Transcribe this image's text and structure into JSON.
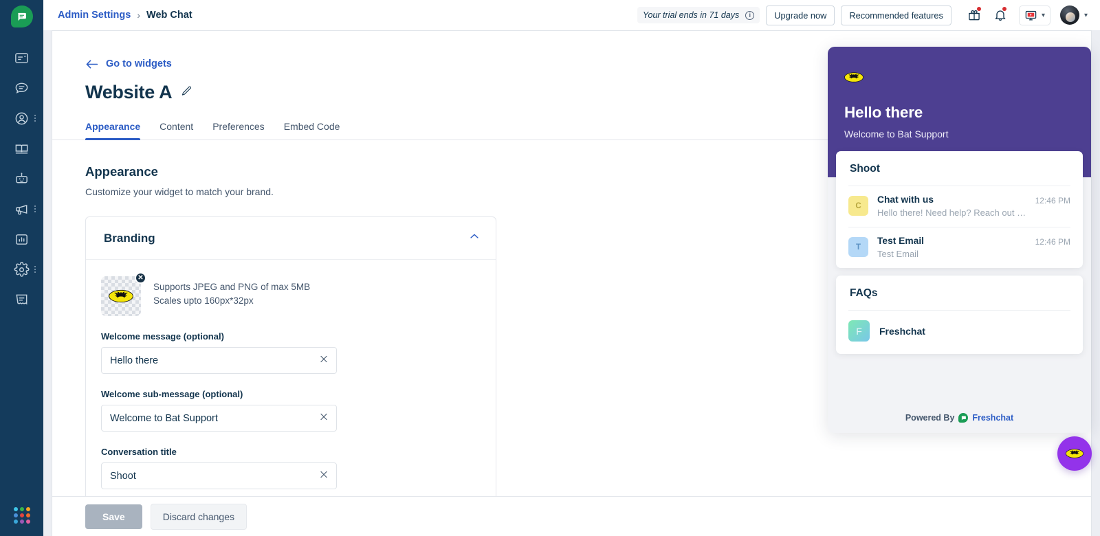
{
  "sidebar": {
    "logo_icon": "freshchat-leaf-logo",
    "items": [
      {
        "icon": "inbox-card-icon",
        "name": "inbox",
        "has_menu": false
      },
      {
        "icon": "chat-bubble-icon",
        "name": "conversations",
        "has_menu": false
      },
      {
        "icon": "contact-person-icon",
        "name": "contacts",
        "has_menu": true
      },
      {
        "icon": "book-icon",
        "name": "knowledge-base",
        "has_menu": false
      },
      {
        "icon": "bot-icon",
        "name": "bots",
        "has_menu": false
      },
      {
        "icon": "megaphone-icon",
        "name": "campaigns",
        "has_menu": true
      },
      {
        "icon": "bar-chart-icon",
        "name": "analytics",
        "has_menu": false
      },
      {
        "icon": "gear-icon",
        "name": "admin-settings",
        "has_menu": true
      },
      {
        "icon": "document-icon",
        "name": "reports",
        "has_menu": false
      }
    ],
    "bottom_logo_icon": "freshworks-dots-logo",
    "bottom_logo_colors": [
      "#3fc6e8",
      "#39b54a",
      "#f5a623",
      "#4a90d9",
      "#e0443e",
      "#ee6a2a",
      "#3aa6d8",
      "#9b59b6",
      "#e05fa0"
    ]
  },
  "topbar": {
    "breadcrumb": {
      "parent": "Admin Settings",
      "separator": "›",
      "current": "Web Chat"
    },
    "trial_text": "Your trial ends in 71 days",
    "info_icon": "info-icon",
    "upgrade_label": "Upgrade now",
    "recommended_label": "Recommended features",
    "gift_icon": "gift-icon",
    "bell_icon": "bell-icon",
    "screen_icon": "monitor-screen-icon",
    "chevron_icon": "chevron-down-icon",
    "avatar_icon": "user-avatar"
  },
  "page": {
    "back_label": "Go to widgets",
    "back_icon": "arrow-left-icon",
    "title": "Website A",
    "edit_icon": "pencil-edit-icon",
    "tabs": [
      {
        "label": "Appearance",
        "active": true
      },
      {
        "label": "Content",
        "active": false
      },
      {
        "label": "Preferences",
        "active": false
      },
      {
        "label": "Embed Code",
        "active": false
      }
    ],
    "section_title": "Appearance",
    "section_subtitle": "Customize your widget to match your brand.",
    "branding": {
      "card_title": "Branding",
      "collapse_icon": "chevron-up-icon",
      "logo_thumb_icon": "batman-logo",
      "remove_icon": "remove-x-icon",
      "help_line_1": "Supports JPEG and PNG of max 5MB",
      "help_line_2": "Scales upto 160px*32px",
      "fields": [
        {
          "label": "Welcome message (optional)",
          "value": "Hello there",
          "clear_icon": "clear-x-icon"
        },
        {
          "label": "Welcome sub-message (optional)",
          "value": "Welcome to Bat Support",
          "clear_icon": "clear-x-icon"
        },
        {
          "label": "Conversation title",
          "value": "Shoot",
          "clear_icon": "clear-x-icon"
        }
      ]
    },
    "actions": {
      "save_label": "Save",
      "save_disabled": true,
      "discard_label": "Discard changes"
    }
  },
  "widget": {
    "header_color": "#4d3f91",
    "launcher_color": "#9333ea",
    "logo_icon": "batman-logo",
    "headline": "Hello there",
    "subhead": "Welcome to Bat Support",
    "conversations": {
      "title": "Shoot",
      "rows": [
        {
          "initial": "C",
          "avatar_color": "#f7e98e",
          "initial_color": "#b6a53d",
          "title": "Chat with us",
          "preview": "Hello there! Need help? Reach out t…",
          "time": "12:46 PM"
        },
        {
          "initial": "T",
          "avatar_color": "#b4d8f7",
          "initial_color": "#5d93c4",
          "title": "Test Email",
          "preview": "Test Email",
          "time": "12:46 PM"
        }
      ]
    },
    "faqs": {
      "title": "FAQs",
      "rows": [
        {
          "initial": "F",
          "label": "Freshchat"
        }
      ]
    },
    "powered_by": "Powered By",
    "powered_brand": "Freshchat",
    "powered_icon": "freshchat-leaf-logo",
    "launcher_icon": "batman-logo"
  }
}
